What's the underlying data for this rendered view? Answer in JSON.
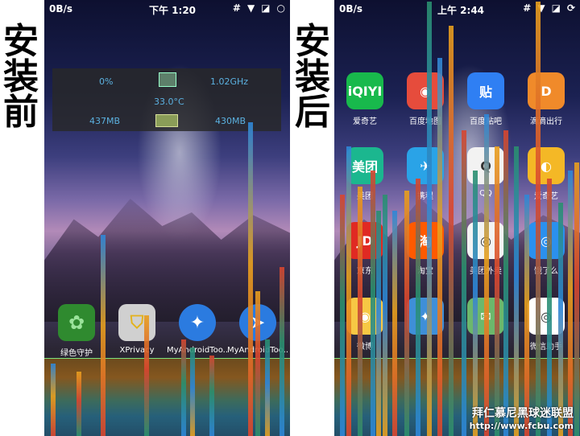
{
  "labels": {
    "before": [
      "安",
      "装",
      "前"
    ],
    "after": [
      "安",
      "装",
      "后"
    ]
  },
  "left_phone": {
    "status": {
      "net": "0B/s",
      "time": "下午 1:20"
    },
    "widget": {
      "cpu": "0%",
      "freq": "1.02GHz",
      "temp": "33.0°C",
      "mem_left": "437MB",
      "mem_right": "430MB"
    },
    "apps": [
      {
        "label": "绿色守护",
        "icon": "leaf-icon",
        "bg": "#2f8a2f"
      },
      {
        "label": "XPrivacy",
        "icon": "shield-doc-icon",
        "bg": "#c9c9c9"
      },
      {
        "label": "MyAndroidToo..",
        "icon": "star-gear-icon",
        "bg": "#2b7be0"
      },
      {
        "label": "MyAndroidToo..",
        "icon": "arrow-icon",
        "bg": "#2b7be0"
      }
    ]
  },
  "right_phone": {
    "status": {
      "net": "0B/s",
      "time": "上午 2:44"
    },
    "apps": [
      {
        "label": "爱奇艺",
        "text": "iQIYI",
        "icon": "iqiyi-icon",
        "bg": "#18b94c"
      },
      {
        "label": "百度地图",
        "text": "◉",
        "icon": "baidu-map-icon",
        "bg": "#e64c3c"
      },
      {
        "label": "百度贴吧",
        "text": "贴",
        "icon": "tieba-icon",
        "bg": "#2f7ff3"
      },
      {
        "label": "滴滴出行",
        "text": "D",
        "icon": "didi-icon",
        "bg": "#f08a2a"
      },
      {
        "label": "美团",
        "text": "美团",
        "icon": "meituan-icon",
        "bg": "#1bb78f"
      },
      {
        "label": "携程",
        "text": "✈",
        "icon": "ctrip-icon",
        "bg": "#2aa3e7"
      },
      {
        "label": "QQ",
        "text": "Q",
        "icon": "qq-icon",
        "bg": "#f2f2f2"
      },
      {
        "label": "爱奇艺",
        "text": "◐",
        "icon": "app-icon",
        "bg": "#f4b826"
      },
      {
        "label": "京东",
        "text": "JD",
        "icon": "jd-icon",
        "bg": "#e02a23"
      },
      {
        "label": "淘宝",
        "text": "淘",
        "icon": "taobao-icon",
        "bg": "#ff5a00"
      },
      {
        "label": "美团外卖",
        "text": "◎",
        "icon": "waimai-icon",
        "bg": "#f3f3f3"
      },
      {
        "label": "饿了么",
        "text": "◎",
        "icon": "eleme-icon",
        "bg": "#2b90ee"
      },
      {
        "label": "微博",
        "text": "◉",
        "icon": "weibo-icon",
        "bg": "#f7c844"
      },
      {
        "label": "",
        "text": "✦",
        "icon": "app-icon",
        "bg": "#3f8fd8"
      },
      {
        "label": "",
        "text": "✉",
        "icon": "app-icon",
        "bg": "#6cb86c"
      },
      {
        "label": "微信助手",
        "text": "◎",
        "icon": "assistant-icon",
        "bg": "#ffffff"
      }
    ]
  },
  "watermark": {
    "line1": "拜仁慕尼黑球迷联盟",
    "line2": "http://www.fcbu.com"
  },
  "colors": {
    "glitch_blue": "#2d86d9",
    "glitch_orange": "#e8a01e",
    "glitch_red": "#d9452f",
    "glitch_green": "#2a8f6e"
  }
}
